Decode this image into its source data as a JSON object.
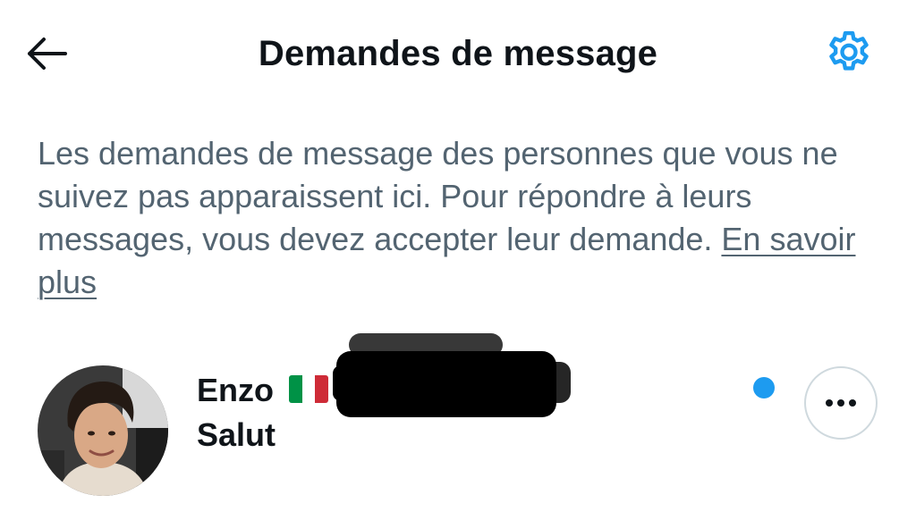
{
  "header": {
    "title": "Demandes de message",
    "back_icon": "arrow-left-icon",
    "settings_icon": "gear-icon"
  },
  "info": {
    "text": "Les demandes de message des personnes que vous ne suivez pas apparaissent ici. Pour répondre à leurs messages, vous devez accepter leur demande. ",
    "link_label": "En savoir plus"
  },
  "requests": [
    {
      "name": "Enzo",
      "flag": "italy-flag-icon",
      "preview": "Salut",
      "unread": true,
      "more_icon": "more-horizontal-icon"
    }
  ],
  "colors": {
    "accent": "#1d9bf0",
    "text_primary": "#0f1419",
    "text_secondary": "#536471",
    "border": "#cfd9de"
  }
}
